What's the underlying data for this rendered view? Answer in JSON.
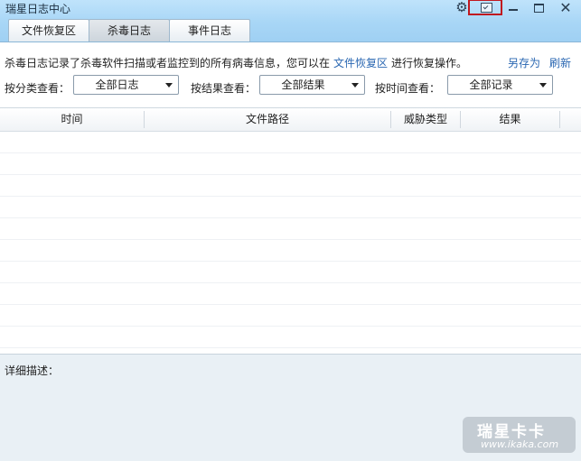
{
  "window": {
    "title": "瑞星日志中心"
  },
  "tabs": [
    {
      "label": "文件恢复区"
    },
    {
      "label": "杀毒日志"
    },
    {
      "label": "事件日志"
    }
  ],
  "info": {
    "text_before": "杀毒日志记录了杀毒软件扫描或者监控到的所有病毒信息，您可以在",
    "link": "文件恢复区",
    "text_after": "进行恢复操作。",
    "save_as": "另存为",
    "refresh": "刷新"
  },
  "filters": {
    "category_label": "按分类查看：",
    "category_value": "全部日志",
    "result_label": "按结果查看：",
    "result_value": "全部结果",
    "time_label": "按时间查看：",
    "time_value": "全部记录"
  },
  "table": {
    "columns": [
      "时间",
      "文件路径",
      "威胁类型",
      "结果"
    ]
  },
  "detail": {
    "label": "详细描述："
  },
  "watermark": {
    "brand": "瑞星卡卡",
    "url": "www.ikaka.com"
  },
  "colors": {
    "accent_link": "#2a67b2",
    "titlebar": "#a8d6f6",
    "highlight": "#c0181f"
  },
  "icons": [
    "gear-icon",
    "skin-icon",
    "minimize-icon",
    "maximize-icon",
    "close-icon"
  ]
}
